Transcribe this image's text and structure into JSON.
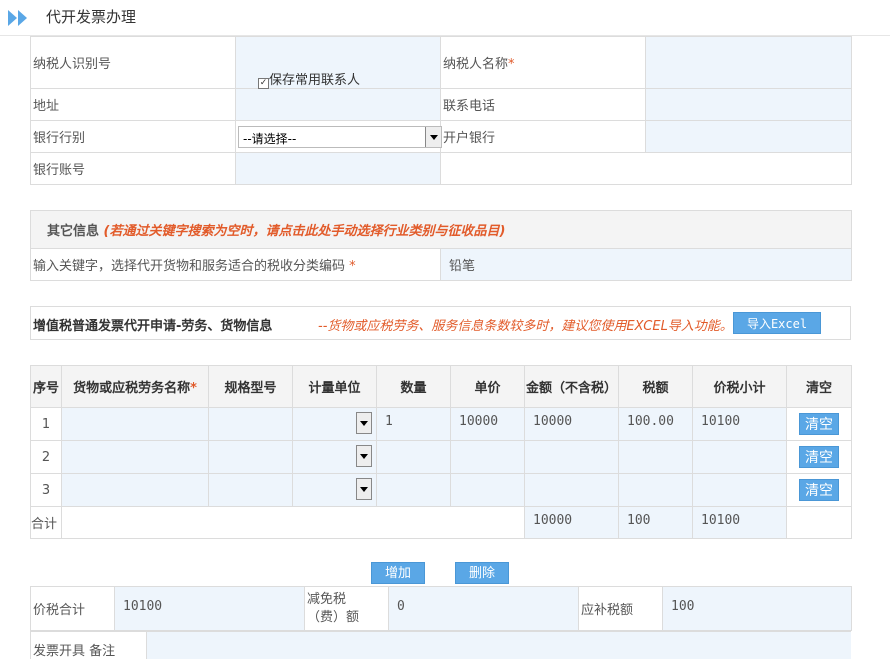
{
  "page": {
    "title": "代开发票办理",
    "accent": "#5aa7e6",
    "required_color": "#e05a2b"
  },
  "taxpayer": {
    "id_label": "纳税人识别号",
    "save_contact_label": "保存常用联系人",
    "name_label": "纳税人名称",
    "required_mark": "*",
    "address_label": "地址",
    "phone_label": "联系电话",
    "bank_type_label": "银行行别",
    "bank_type_value": "--请选择--",
    "bank_label": "开户银行",
    "account_label": "银行账号"
  },
  "other": {
    "title": "其它信息",
    "hint": "(若通过关键字搜索为空时，请点击此处手动选择行业类别与征收品目)",
    "keyword_label": "输入关键字，选择代开货物和服务适合的税收分类编码",
    "keyword_value": "铅笔"
  },
  "goods": {
    "title": "增值税普通发票代开申请-劳务、货物信息",
    "hint": "--货物或应税劳务、服务信息条数较多时，建议您使用EXCEL导入功能。",
    "import_label": "导入Excel"
  },
  "items": {
    "headers": [
      "序号",
      "货物或应税劳务名称",
      "规格型号",
      "计量单位",
      "数量",
      "单价",
      "金额（不含税）",
      "税额",
      "价税小计",
      "清空"
    ],
    "rows": [
      {
        "seq": "1",
        "qty": "1",
        "price": "10000",
        "amount": "10000",
        "tax": "100.00",
        "subtotal": "10100",
        "clear": "清空"
      },
      {
        "seq": "2",
        "qty": "",
        "price": "",
        "amount": "",
        "tax": "",
        "subtotal": "",
        "clear": "清空"
      },
      {
        "seq": "3",
        "qty": "",
        "price": "",
        "amount": "",
        "tax": "",
        "subtotal": "",
        "clear": "清空"
      }
    ],
    "total_label": "合计",
    "total_amount": "10000",
    "total_tax": "100",
    "total_subtotal": "10100"
  },
  "actions": {
    "add_label": "增加",
    "delete_label": "删除"
  },
  "summary": {
    "total_label": "价税合计",
    "total_value": "10100",
    "reduce_label_1": "减免税",
    "reduce_label_2": "（费）额",
    "reduce_value": "0",
    "due_label": "应补税额",
    "due_value": "100",
    "remark_label": "发票开具 备注"
  }
}
